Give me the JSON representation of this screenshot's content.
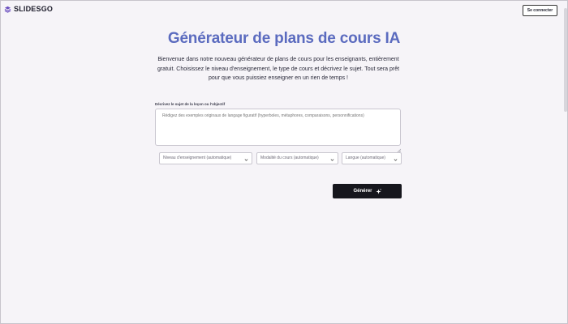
{
  "header": {
    "logo_text": "SLIDESGO",
    "login_label": "Se connecter"
  },
  "main": {
    "title": "Générateur de plans de cours IA",
    "intro": "Bienvenue dans notre nouveau générateur de plans de cours pour les enseignants, entièrement gratuit. Choisissez le niveau d'enseignement, le type de cours et décrivez le sujet. Tout sera prêt pour que vous puissiez enseigner en un rien de temps !",
    "topic_label": "Décrivez le sujet de la leçon ou l'objectif",
    "topic_placeholder": "Rédigez des exemples originaux de langage figuratif (hyperboles, métaphores, comparaisons, personnifications)",
    "selects": {
      "level": "Niveau d'enseignement (automatique)",
      "modality": "Modalité du cours (automatique)",
      "language": "Langue (automatique)"
    },
    "generate_label": "Générer"
  },
  "colors": {
    "title": "#5b6bbf",
    "background": "#f6f4f8",
    "button": "#16161d"
  },
  "icons": [
    "slidesgo-logo-icon",
    "chevron-down-icon",
    "sparkle-icon",
    "resize-grip-icon"
  ]
}
